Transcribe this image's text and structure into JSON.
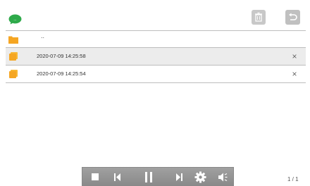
{
  "header": {
    "logo_icon": "chat-bubble-icon",
    "logo_text": "...",
    "trash_icon": "trash-icon",
    "back_icon": "return-arrow-icon"
  },
  "colors": {
    "folder": "#f5a623",
    "logo": "#2eaa4a",
    "toolbar": "#949494"
  },
  "list": {
    "parent_label": "..",
    "items": [
      {
        "label": "2020-07-09 14:25:58",
        "selected": true,
        "delete_label": "×"
      },
      {
        "label": "2020-07-09 14:25:54",
        "selected": false,
        "delete_label": "×"
      }
    ]
  },
  "player": {
    "buttons": [
      {
        "name": "stop-icon"
      },
      {
        "name": "previous-icon"
      },
      {
        "name": "pause-icon"
      },
      {
        "name": "next-icon"
      },
      {
        "name": "settings-gear-icon"
      },
      {
        "name": "speaker-icon"
      }
    ]
  },
  "pagination": {
    "label": "1 / 1"
  }
}
